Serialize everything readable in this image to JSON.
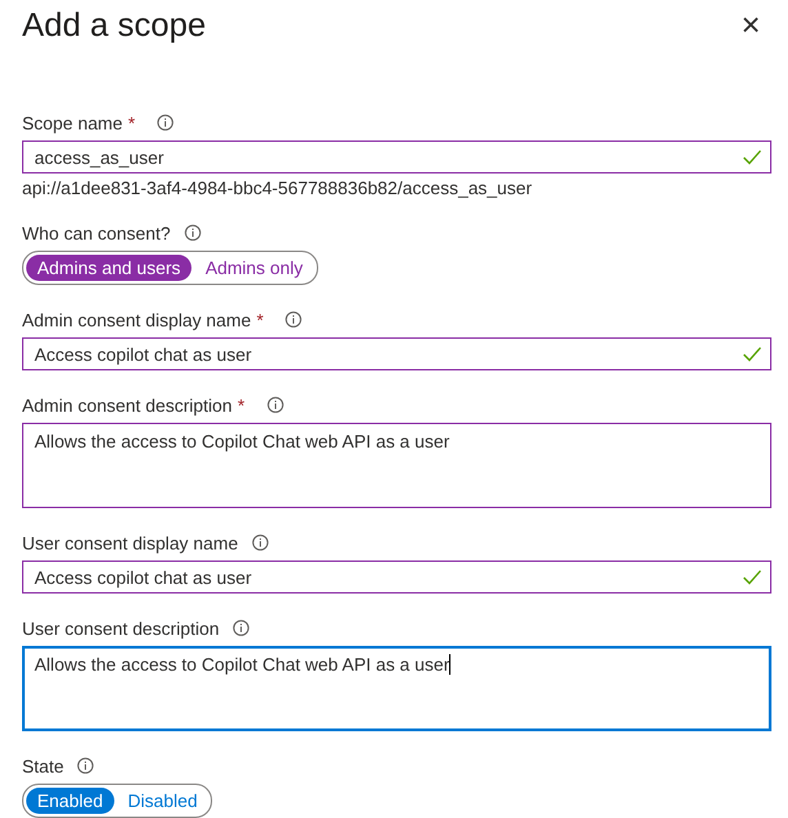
{
  "panel": {
    "title": "Add a scope",
    "close_label": "×"
  },
  "fields": [
    {
      "kind": "text",
      "label": "Scope name",
      "required_mark": "*",
      "value": "access_as_user",
      "valid": true,
      "focused": false,
      "hint": "api://a1dee831-3af4-4984-bbc4-567788836b82/access_as_user"
    },
    {
      "kind": "toggle",
      "label": "Who can consent?",
      "color": "#8a2da5",
      "options": [
        {
          "label": "Admins and users",
          "selected": true
        },
        {
          "label": "Admins only",
          "selected": false
        }
      ]
    },
    {
      "kind": "text",
      "label": "Admin consent display name",
      "required_mark": "*",
      "value": "Access copilot chat as user",
      "valid": true,
      "focused": false
    },
    {
      "kind": "textarea",
      "label": "Admin consent description",
      "required_mark": "*",
      "value": "Allows the access to Copilot Chat web API as a user",
      "focused": false
    },
    {
      "kind": "text",
      "label": "User consent display name",
      "value": "Access copilot chat as user",
      "valid": true,
      "focused": false
    },
    {
      "kind": "textarea",
      "label": "User consent description",
      "value": "Allows the access to Copilot Chat web API as a user",
      "focused": true
    },
    {
      "kind": "toggle",
      "label": "State",
      "color": "#0078d4",
      "options": [
        {
          "label": "Enabled",
          "selected": true
        },
        {
          "label": "Disabled",
          "selected": false
        }
      ]
    }
  ]
}
